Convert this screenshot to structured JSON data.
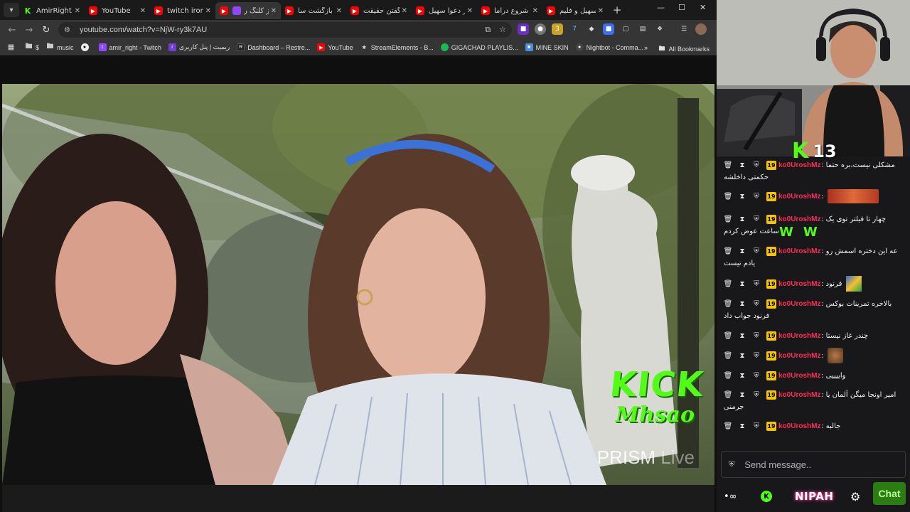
{
  "tabs": [
    {
      "label": "AmirRight St",
      "icon": "kick-icon",
      "active": false
    },
    {
      "label": "YouTube",
      "icon": "youtube-icon",
      "active": false
    },
    {
      "label": "twitch ironi",
      "icon": "youtube-icon",
      "active": false
    },
    {
      "label": "از کلنگ ر",
      "icon": "youtube-icon",
      "active": true
    },
    {
      "label": "از بازگشت سا",
      "icon": "youtube-icon",
      "active": false
    },
    {
      "label": "از گفتن حقیقت",
      "icon": "youtube-icon",
      "active": false
    },
    {
      "label": "از دعوا سهیل",
      "icon": "youtube-icon",
      "active": false
    },
    {
      "label": "از شروع دراما",
      "icon": "youtube-icon",
      "active": false
    },
    {
      "label": "سهیل و فلیم",
      "icon": "youtube-icon",
      "active": false
    }
  ],
  "address": {
    "url": "youtube.com/watch?v=NjW-ry3k7AU"
  },
  "bookmarks": [
    {
      "label": "$",
      "icon": "folder-icon"
    },
    {
      "label": "music",
      "icon": "folder-icon"
    },
    {
      "label": "",
      "icon": "github-icon"
    },
    {
      "label": "amir_right - Twitch",
      "icon": "twitch-icon"
    },
    {
      "label": "ریمیت | پنل کاربری",
      "icon": "remit-icon"
    },
    {
      "label": "Dashboard – Restre...",
      "icon": "restream-icon"
    },
    {
      "label": "YouTube",
      "icon": "youtube-icon"
    },
    {
      "label": "StreamElements - B...",
      "icon": "streamelements-icon"
    },
    {
      "label": "GIGACHAD PLAYLIS...",
      "icon": "spotify-icon"
    },
    {
      "label": "MINE SKIN",
      "icon": "mineskin-icon"
    },
    {
      "label": "Nightbot - Comma...",
      "icon": "nightbot-icon"
    }
  ],
  "all_bookmarks": "All Bookmarks",
  "video": {
    "watermark_brand": "KICK",
    "watermark_user": "Mhsao",
    "prism_brand": "PRISM",
    "prism_suffix": "Live"
  },
  "stream": {
    "viewer_count": "13",
    "viewer_logo": "K"
  },
  "chat": {
    "badge": "19",
    "username": "ko0UroshMz",
    "messages": [
      {
        "text": "مشکلی نیست،بره حتما",
        "wrap": "حکمتی داخلشه",
        "emote": ""
      },
      {
        "text": "",
        "wrap": "",
        "emote": "pepe-emote"
      },
      {
        "text": "چهار تا فیلتر توی یک",
        "wrap": "ساعت عوض کردم",
        "emote": "ww-emote"
      },
      {
        "text": "عه این دختره اسمش رو",
        "wrap": "یادم نیست",
        "emote": ""
      },
      {
        "text": "فرنود",
        "wrap": "",
        "emote": "book-emote"
      },
      {
        "text": "بالاخره تمرینات بوکس",
        "wrap": "فرنود جواب داد",
        "emote": ""
      },
      {
        "text": "چندر غاز نیستا",
        "wrap": "",
        "emote": ""
      },
      {
        "text": "",
        "wrap": "",
        "emote": "cat-emote"
      },
      {
        "text": "واییییی",
        "wrap": "",
        "emote": ""
      },
      {
        "text": "امیر اونجا میگن آلمان یا",
        "wrap": "جرمنی",
        "emote": ""
      },
      {
        "text": "جالبه",
        "wrap": "",
        "emote": ""
      }
    ],
    "input_placeholder": "Send message..",
    "send_label": "Chat",
    "nipah_label": "NIPAH"
  }
}
